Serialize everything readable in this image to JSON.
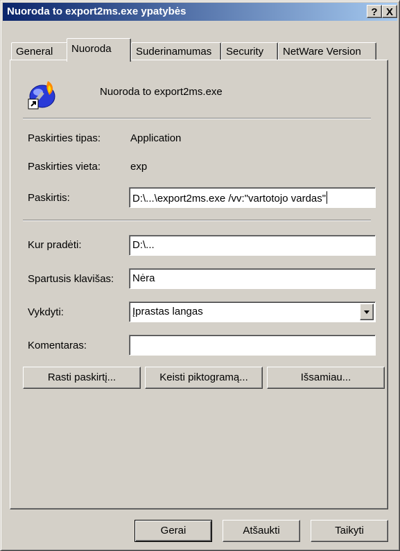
{
  "window": {
    "title": "Nuoroda to export2ms.exe ypatybės",
    "help_button": "?",
    "close_button": "X"
  },
  "tabs": [
    {
      "label": "General",
      "active": false
    },
    {
      "label": "Nuoroda",
      "active": true
    },
    {
      "label": "Suderinamumas",
      "active": false
    },
    {
      "label": "Security",
      "active": false
    },
    {
      "label": "NetWare Version",
      "active": false
    }
  ],
  "shortcut": {
    "icon": "shortcut-torch-icon",
    "name": "Nuoroda to export2ms.exe",
    "target_type_label": "Paskirties tipas:",
    "target_type_value": "Application",
    "target_location_label": "Paskirties vieta:",
    "target_location_value": "exp",
    "target_label": "Paskirtis:",
    "target_value": "D:\\...\\export2ms.exe /vv:\"vartotojo vardas\""
  },
  "fields": {
    "start_in_label": "Kur pradėti:",
    "start_in_value": "D:\\...",
    "shortcut_key_label": "Spartusis klavišas:",
    "shortcut_key_value": "Nėra",
    "run_label": "Vykdyti:",
    "run_value": "Įprastas langas",
    "comment_label": "Komentaras:",
    "comment_value": ""
  },
  "actions": {
    "find_target": "Rasti paskirtį...",
    "change_icon": "Keisti piktogramą...",
    "advanced": "Išsamiau..."
  },
  "footer": {
    "ok": "Gerai",
    "cancel": "Atšaukti",
    "apply": "Taikyti"
  },
  "colors": {
    "title_gradient_start": "#0a246a",
    "title_gradient_end": "#a6caf0",
    "face": "#d4d0c8"
  }
}
